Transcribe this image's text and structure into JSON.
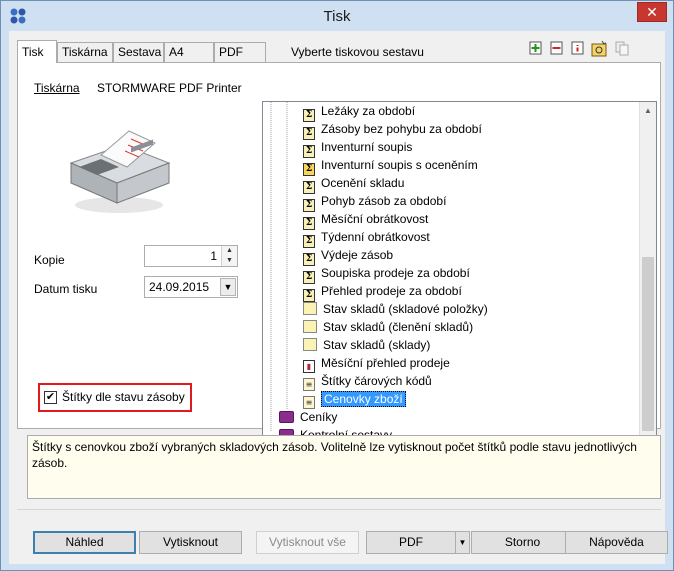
{
  "window": {
    "title": "Tisk"
  },
  "tabs": [
    "Tisk",
    "Tiskárna",
    "Sestava",
    "A4",
    "PDF"
  ],
  "tab_caption": "Vyberte tiskovou sestavu",
  "toolbar": {
    "icons": [
      "add-icon",
      "remove-icon",
      "info-icon",
      "manage-icon",
      "copy-icon"
    ]
  },
  "printer": {
    "label": "Tiskárna",
    "name": "STORMWARE PDF Printer"
  },
  "copies": {
    "label": "Kopie",
    "value": "1"
  },
  "print_date": {
    "label": "Datum tisku",
    "value": "24.09.2015"
  },
  "option": {
    "label": "Štítky dle stavu zásoby",
    "checked": true
  },
  "tree": {
    "items": [
      {
        "label": "Ležáky za období",
        "icon": "sigma"
      },
      {
        "label": "Zásoby bez pohybu za období",
        "icon": "sigma"
      },
      {
        "label": "Inventurní soupis",
        "icon": "sigma"
      },
      {
        "label": "Inventurní soupis s oceněním",
        "icon": "sigma2"
      },
      {
        "label": "Ocenění skladu",
        "icon": "sigma"
      },
      {
        "label": "Pohyb zásob za období",
        "icon": "sigma"
      },
      {
        "label": "Měsíční obrátkovost",
        "icon": "sigma"
      },
      {
        "label": "Týdenní obrátkovost",
        "icon": "sigma"
      },
      {
        "label": "Výdeje zásob",
        "icon": "sigma"
      },
      {
        "label": "Soupiska prodeje za období",
        "icon": "sigma"
      },
      {
        "label": "Přehled prodeje za období",
        "icon": "sigma"
      },
      {
        "label": "Stav skladů (skladové položky)",
        "icon": "yellow"
      },
      {
        "label": "Stav skladů (členění skladů)",
        "icon": "yellow"
      },
      {
        "label": "Stav skladů (sklady)",
        "icon": "yellow"
      },
      {
        "label": "Měsíční přehled prodeje",
        "icon": "chart"
      },
      {
        "label": "Štítky čárových kódů",
        "icon": "label"
      },
      {
        "label": "Cenovky zboží",
        "icon": "label",
        "selected": true
      }
    ],
    "groups": [
      {
        "label": "Ceníky"
      },
      {
        "label": "Kontrolní sestavy"
      }
    ]
  },
  "description": "Štítky s cenovkou zboží vybraných skladových zásob. Volitelně lze vytisknout počet štítků podle stavu jednotlivých zásob.",
  "buttons": {
    "preview": "Náhled",
    "print": "Vytisknout",
    "print_all": "Vytisknout vše",
    "pdf": "PDF",
    "cancel": "Storno",
    "help": "Nápověda"
  }
}
